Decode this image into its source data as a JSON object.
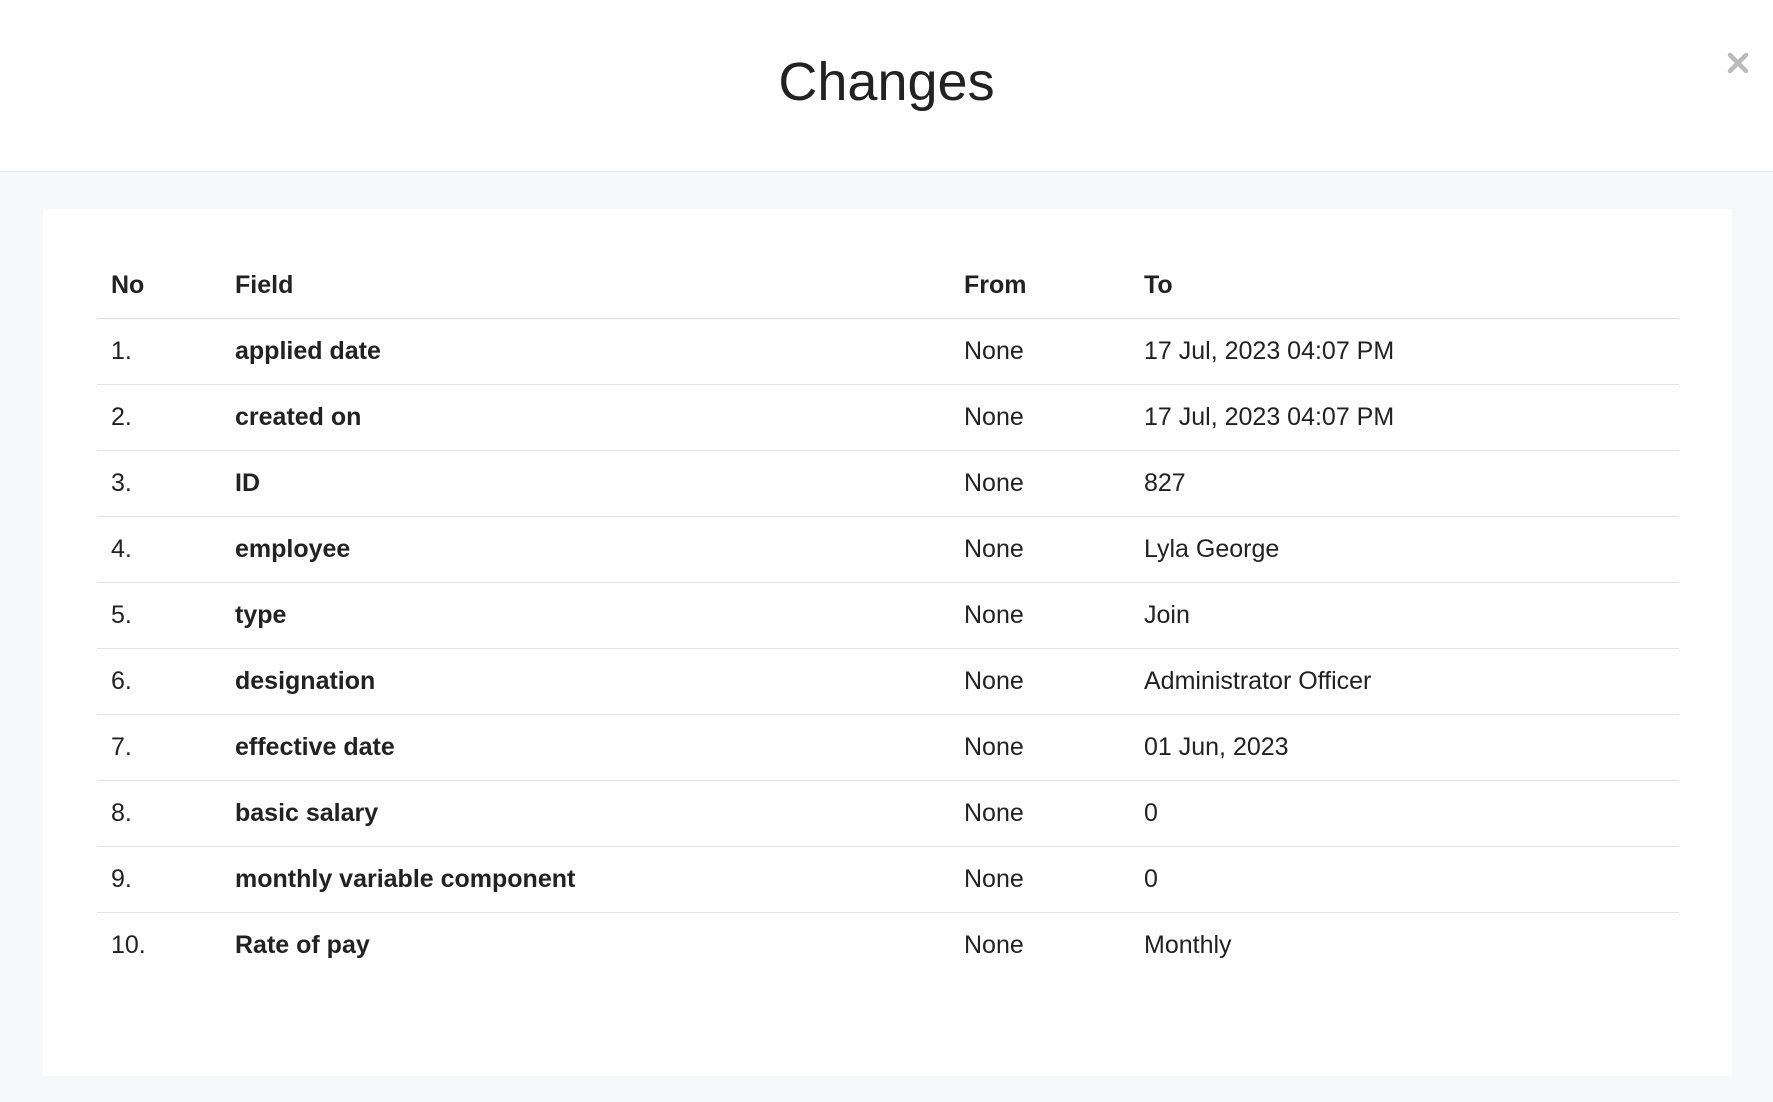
{
  "modal": {
    "title": "Changes"
  },
  "table": {
    "headers": {
      "no": "No",
      "field": "Field",
      "from": "From",
      "to": "To"
    },
    "rows": [
      {
        "no": "1.",
        "field": "applied date",
        "from": "None",
        "to": "17 Jul, 2023 04:07 PM"
      },
      {
        "no": "2.",
        "field": "created on",
        "from": "None",
        "to": "17 Jul, 2023 04:07 PM"
      },
      {
        "no": "3.",
        "field": "ID",
        "from": "None",
        "to": "827"
      },
      {
        "no": "4.",
        "field": "employee",
        "from": "None",
        "to": "Lyla George"
      },
      {
        "no": "5.",
        "field": "type",
        "from": "None",
        "to": "Join"
      },
      {
        "no": "6.",
        "field": "designation",
        "from": "None",
        "to": "Administrator Officer"
      },
      {
        "no": "7.",
        "field": "effective date",
        "from": "None",
        "to": "01 Jun, 2023"
      },
      {
        "no": "8.",
        "field": "basic salary",
        "from": "None",
        "to": "0"
      },
      {
        "no": "9.",
        "field": "monthly variable component",
        "from": "None",
        "to": "0"
      },
      {
        "no": "10.",
        "field": "Rate of pay",
        "from": "None",
        "to": "Monthly"
      }
    ]
  },
  "icons": {
    "close": "close-icon"
  },
  "colors": {
    "text": "#222222",
    "body_background": "#f6f8f9",
    "divider": "#e3e6e9",
    "close_icon": "#bbbbbb"
  }
}
